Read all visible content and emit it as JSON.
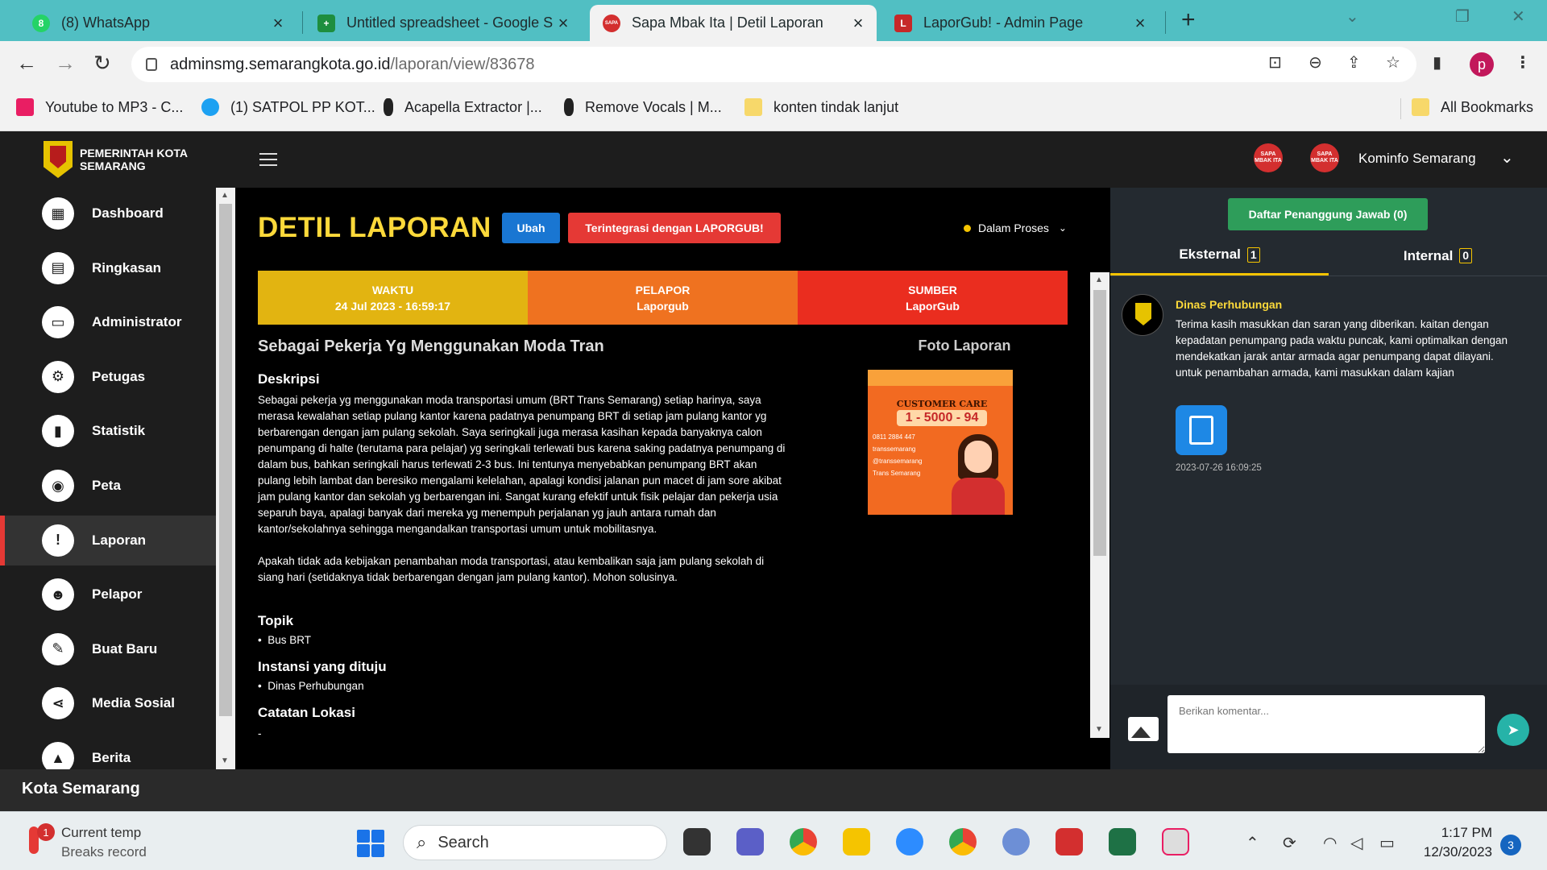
{
  "browser": {
    "tabs": [
      {
        "title": "(8) WhatsApp",
        "favicon": "whatsapp-icon",
        "color": "#25d366"
      },
      {
        "title": "Untitled spreadsheet - Google S",
        "favicon": "sheets-icon",
        "color": "#1e8e3e"
      },
      {
        "title": "Sapa Mbak Ita | Detil Laporan",
        "favicon": "sapa-icon",
        "color": "#d32f2f"
      },
      {
        "title": "LaporGub! - Admin Page",
        "favicon": "laporgub-icon",
        "color": "#c62828"
      }
    ],
    "url_host": "adminsmg.semarangkota.go.id",
    "url_path": "/laporan/view/83678",
    "profile_initial": "p",
    "bookmarks": [
      "Youtube to MP3 - C...",
      "(1) SATPOL PP KOT...",
      "Acapella Extractor |...",
      "Remove Vocals | M...",
      "konten tindak lanjut"
    ],
    "all_bookmarks": "All Bookmarks"
  },
  "header": {
    "brand_line1": "PEMERINTAH KOTA",
    "brand_line2": "SEMARANG",
    "badge_text": "SAPA MBAK ITA",
    "user": "Kominfo Semarang"
  },
  "sidebar": {
    "items": [
      {
        "label": "Dashboard",
        "icon": "dashboard-icon",
        "glyph": "▦"
      },
      {
        "label": "Ringkasan",
        "icon": "summary-icon",
        "glyph": "▤"
      },
      {
        "label": "Administrator",
        "icon": "monitor-icon",
        "glyph": "▭"
      },
      {
        "label": "Petugas",
        "icon": "officer-icon",
        "glyph": "⚙"
      },
      {
        "label": "Statistik",
        "icon": "stats-icon",
        "glyph": "▮"
      },
      {
        "label": "Peta",
        "icon": "map-pin-icon",
        "glyph": "◉"
      },
      {
        "label": "Laporan",
        "icon": "report-icon",
        "glyph": "!"
      },
      {
        "label": "Pelapor",
        "icon": "reporter-icon",
        "glyph": "☻"
      },
      {
        "label": "Buat Baru",
        "icon": "pencil-icon",
        "glyph": "✎"
      },
      {
        "label": "Media Sosial",
        "icon": "share-icon",
        "glyph": "⋖"
      },
      {
        "label": "Berita",
        "icon": "news-icon",
        "glyph": "▲"
      }
    ],
    "active": "Laporan"
  },
  "main": {
    "title": "DETIL LAPORAN",
    "edit_label": "Ubah",
    "integrated_label": "Terintegrasi dengan LAPORGUB!",
    "status": "Dalam Proses",
    "info": [
      {
        "label": "WAKTU",
        "value": "24 Jul 2023 - 16:59:17",
        "color": "#e2b411"
      },
      {
        "label": "PELAPOR",
        "value": "Laporgub",
        "color": "#ef7220"
      },
      {
        "label": "SUMBER",
        "value": "LaporGub",
        "color": "#ea2d1f"
      }
    ],
    "report_title": "Sebagai Pekerja Yg Menggunakan Moda Tran",
    "desc_heading": "Deskripsi",
    "desc_p1": "Sebagai pekerja yg menggunakan moda transportasi umum (BRT Trans Semarang) setiap harinya, saya merasa kewalahan setiap pulang kantor karena padatnya penumpang BRT di setiap jam pulang kantor yg berbarengan dengan jam pulang sekolah. Saya seringkali juga merasa kasihan kepada banyaknya calon penumpang di halte (terutama para pelajar) yg seringkali terlewati bus karena saking padatnya penumpang di dalam bus, bahkan seringkali harus terlewati 2-3 bus. Ini tentunya menyebabkan penumpang BRT akan pulang lebih lambat dan beresiko mengalami kelelahan, apalagi kondisi jalanan pun macet di jam sore akibat jam pulang kantor dan sekolah yg berbarengan ini. Sangat kurang efektif untuk fisik pelajar dan pekerja usia separuh baya, apalagi banyak dari mereka yg menempuh perjalanan yg jauh antara rumah dan kantor/sekolahnya sehingga mengandalkan transportasi umum untuk mobilitasnya.",
    "desc_p2": "Apakah tidak ada kebijakan penambahan moda transportasi, atau kembalikan saja jam pulang sekolah di siang hari (setidaknya tidak berbarengan dengan jam pulang kantor). Mohon solusinya.",
    "topic_heading": "Topik",
    "topic": "Bus BRT",
    "agency_heading": "Instansi yang dituju",
    "agency": "Dinas Perhubungan",
    "location_heading": "Catatan Lokasi",
    "location": "-",
    "photo_heading": "Foto Laporan",
    "poster": {
      "heading": "CUSTOMER CARE",
      "number": "1 - 5000 - 94",
      "lines": [
        "0811 2884 447",
        "transsemarang",
        "@transsemarang",
        "Trans Semarang"
      ]
    }
  },
  "panel": {
    "responsible_label": "Daftar Penanggung Jawab (0)",
    "tab_external": "Eksternal",
    "tab_external_count": "1",
    "tab_internal": "Internal",
    "tab_internal_count": "0",
    "comment": {
      "author": "Dinas Perhubungan",
      "text": "Terima kasih masukkan dan saran yang diberikan. kaitan dengan kepadatan penumpang pada waktu puncak, kami optimalkan dengan mendekatkan jarak antar armada agar penumpang dapat dilayani. untuk penambahan armada, kami masukkan dalam kajian",
      "time": "2023-07-26 16:09:25"
    },
    "comment_placeholder": "Berikan komentar..."
  },
  "footer": {
    "text": "Kota Semarang"
  },
  "taskbar": {
    "weather_line1": "Current temp",
    "weather_line2": "Breaks record",
    "weather_badge": "1",
    "search": "Search",
    "time": "1:17 PM",
    "date": "12/30/2023",
    "notifications": "3"
  }
}
